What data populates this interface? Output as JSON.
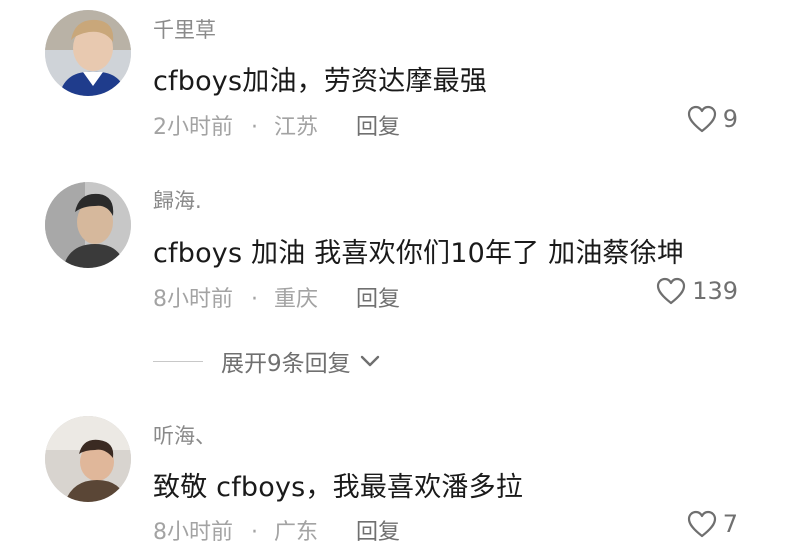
{
  "comments": [
    {
      "user": "千里草",
      "text": "cfboys加油，劳资达摩最强",
      "time": "2小时前",
      "dot": "·",
      "location": "江苏",
      "reply": "回复",
      "likes": "9"
    },
    {
      "user": "歸海.",
      "text": "cfboys 加油 我喜欢你们10年了 加油蔡徐坤",
      "time": "8小时前",
      "dot": "·",
      "location": "重庆",
      "reply": "回复",
      "likes": "139"
    },
    {
      "user": "听海、",
      "text": "致敬 cfboys，我最喜欢潘多拉",
      "time": "8小时前",
      "dot": "·",
      "location": "广东",
      "reply": "回复",
      "likes": "7"
    }
  ],
  "expand_replies": "展开9条回复",
  "icons": {
    "like": "heart-outline-icon",
    "expand": "chevron-down-icon"
  },
  "colors": {
    "meta": "#a3a3a3",
    "username": "#8a8a8a",
    "text": "#1a1a1a"
  }
}
